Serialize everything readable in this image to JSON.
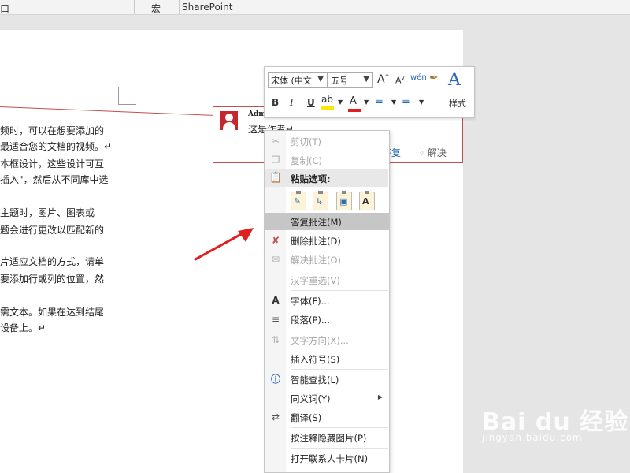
{
  "ribbon": {
    "tab_window": "口",
    "tab_macro": "宏",
    "tab_sharepoint": "SharePoint"
  },
  "document": {
    "lines": [
      "频时，可以在想要添加的",
      "最适合您的文档的视频。↵",
      "本框设计，这些设计可互",
      "插入\"，然后从不同库中选",
      "主题时，图片、图表或",
      "题会进行更改以匹配新的",
      "片适应文档的方式，请单",
      "要添加行或列的位置，然",
      "需文本。如果在达到结尾",
      "设备上。↵"
    ]
  },
  "comment": {
    "author": "Adm",
    "text": "这是作者↵",
    "reply_label": "答复",
    "resolve_label": "解决"
  },
  "mini_toolbar": {
    "font_name": "宋体 (中文",
    "font_size": "五号",
    "grow_font": "A",
    "shrink_font": "A",
    "phonetic": "wén",
    "bold": "B",
    "italic": "I",
    "underline": "U",
    "font_color": "A",
    "styles_label": "样式",
    "highlight_color": "#ffe600",
    "text_color": "#e02020"
  },
  "context_menu": {
    "items": [
      {
        "label": "剪切(T)",
        "icon": "cut-icon",
        "disabled": true
      },
      {
        "label": "复制(C)",
        "icon": "copy-icon",
        "disabled": true
      },
      {
        "label": "粘贴选项:",
        "icon": "paste-icon",
        "header": true
      },
      {
        "label": "答复批注(M)",
        "highlighted": true
      },
      {
        "label": "删除批注(D)",
        "icon": "delete-comment-icon"
      },
      {
        "label": "解决批注(O)",
        "icon": "resolve-comment-icon",
        "disabled": true
      },
      {
        "label": "汉字重选(V)",
        "disabled": true
      },
      {
        "label": "字体(F)...",
        "icon": "font-icon"
      },
      {
        "label": "段落(P)...",
        "icon": "paragraph-icon"
      },
      {
        "label": "文字方向(X)...",
        "icon": "text-direction-icon",
        "disabled": true
      },
      {
        "label": "插入符号(S)"
      },
      {
        "label": "智能查找(L)",
        "icon": "smart-lookup-icon"
      },
      {
        "label": "同义词(Y)",
        "submenu": true
      },
      {
        "label": "翻译(S)",
        "icon": "translate-icon"
      },
      {
        "label": "按注释隐藏图片(P)"
      },
      {
        "label": "打开联系人卡片(N)"
      }
    ]
  },
  "watermark": {
    "main": "Bai du 经验",
    "sub": "jingyan.baidu.com"
  },
  "colors": {
    "accent_red": "#c0504d",
    "link_blue": "#2b6ab3",
    "arrow_red": "#e02020"
  }
}
